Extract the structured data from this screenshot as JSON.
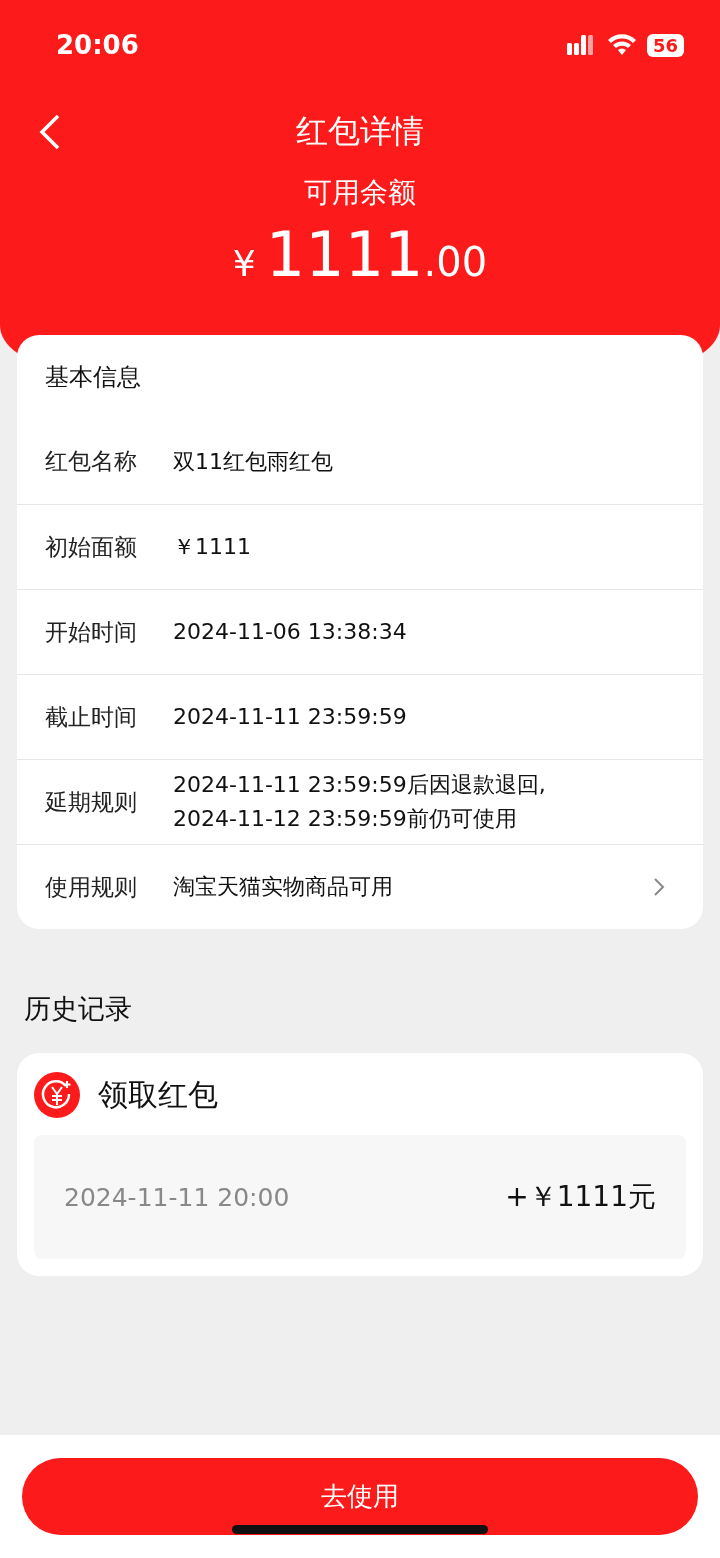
{
  "status_bar": {
    "time": "20:06",
    "battery": "56"
  },
  "nav": {
    "title": "红包详情"
  },
  "balance": {
    "label": "可用余额",
    "currency": "¥",
    "integer": "1111",
    "decimal": ".00"
  },
  "info": {
    "title": "基本信息",
    "rows": [
      {
        "label": "红包名称",
        "value": "双11红包雨红包",
        "kind": "text"
      },
      {
        "label": "初始面额",
        "value": "￥1111",
        "kind": "text"
      },
      {
        "label": "开始时间",
        "value": "2024-11-06 13:38:34",
        "kind": "text"
      },
      {
        "label": "截止时间",
        "value": "2024-11-11 23:59:59",
        "kind": "text"
      },
      {
        "label": "延期规则",
        "value": "2024-11-11 23:59:59后因退款退回,\n2024-11-12 23:59:59前仍可使用",
        "kind": "text"
      },
      {
        "label": "使用规则",
        "value": "淘宝天猫实物商品可用",
        "kind": "link"
      }
    ]
  },
  "history": {
    "title": "历史记录",
    "records": [
      {
        "title": "领取红包",
        "time": "2024-11-11 20:00",
        "amount": "+￥1111元"
      }
    ]
  },
  "action": {
    "label": "去使用"
  }
}
